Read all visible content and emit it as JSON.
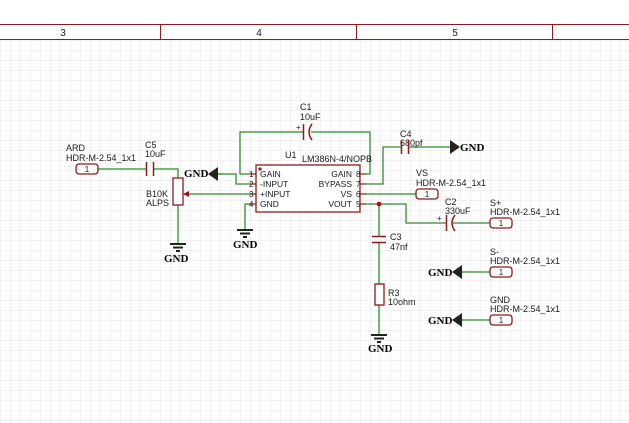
{
  "ruler": [
    "3",
    "4",
    "5"
  ],
  "colors": {
    "wire": "#2e8b2e",
    "part": "#8b1a1a",
    "junction": "#cc0000",
    "grid": "#e6e6e6",
    "text": "#1a1a1a"
  },
  "icons": {
    "gnd": "ground-arrow-icon",
    "earth": "ground-bars-icon"
  },
  "ard": {
    "ref": "ARD",
    "value": "HDR-M-2.54_1x1",
    "pin": "1"
  },
  "c5": {
    "ref": "C5",
    "value": "10uF"
  },
  "pot": {
    "ref": "B10K",
    "value": "ALPS"
  },
  "c1": {
    "ref": "C1",
    "value": "10uF",
    "plus": "+"
  },
  "c4": {
    "ref": "C4",
    "value": "680pf"
  },
  "u1": {
    "ref": "U1",
    "part": "LM386N-4/NOPB",
    "left_pins": [
      {
        "num": "1",
        "label": "GAIN"
      },
      {
        "num": "2",
        "label": "-INPUT"
      },
      {
        "num": "3",
        "label": "+INPUT"
      },
      {
        "num": "4",
        "label": "GND"
      }
    ],
    "right_pins": [
      {
        "num": "8",
        "label": "GAIN"
      },
      {
        "num": "7",
        "label": "BYPASS"
      },
      {
        "num": "6",
        "label": "VS"
      },
      {
        "num": "5",
        "label": "VOUT"
      }
    ]
  },
  "vs": {
    "ref": "VS",
    "value": "HDR-M-2.54_1x1",
    "pin": "1"
  },
  "c2": {
    "ref": "C2",
    "value": "330uF",
    "plus": "+"
  },
  "sp": {
    "ref": "S+",
    "value": "HDR-M-2.54_1x1",
    "pin": "1"
  },
  "sm": {
    "ref": "S-",
    "value": "HDR-M-2.54_1x1",
    "pin": "1"
  },
  "gh": {
    "ref": "GND",
    "value": "HDR-M-2.54_1x1",
    "pin": "1"
  },
  "c3": {
    "ref": "C3",
    "value": "47nf"
  },
  "r3": {
    "ref": "R3",
    "value": "10ohm"
  },
  "gnd_label": "GND"
}
